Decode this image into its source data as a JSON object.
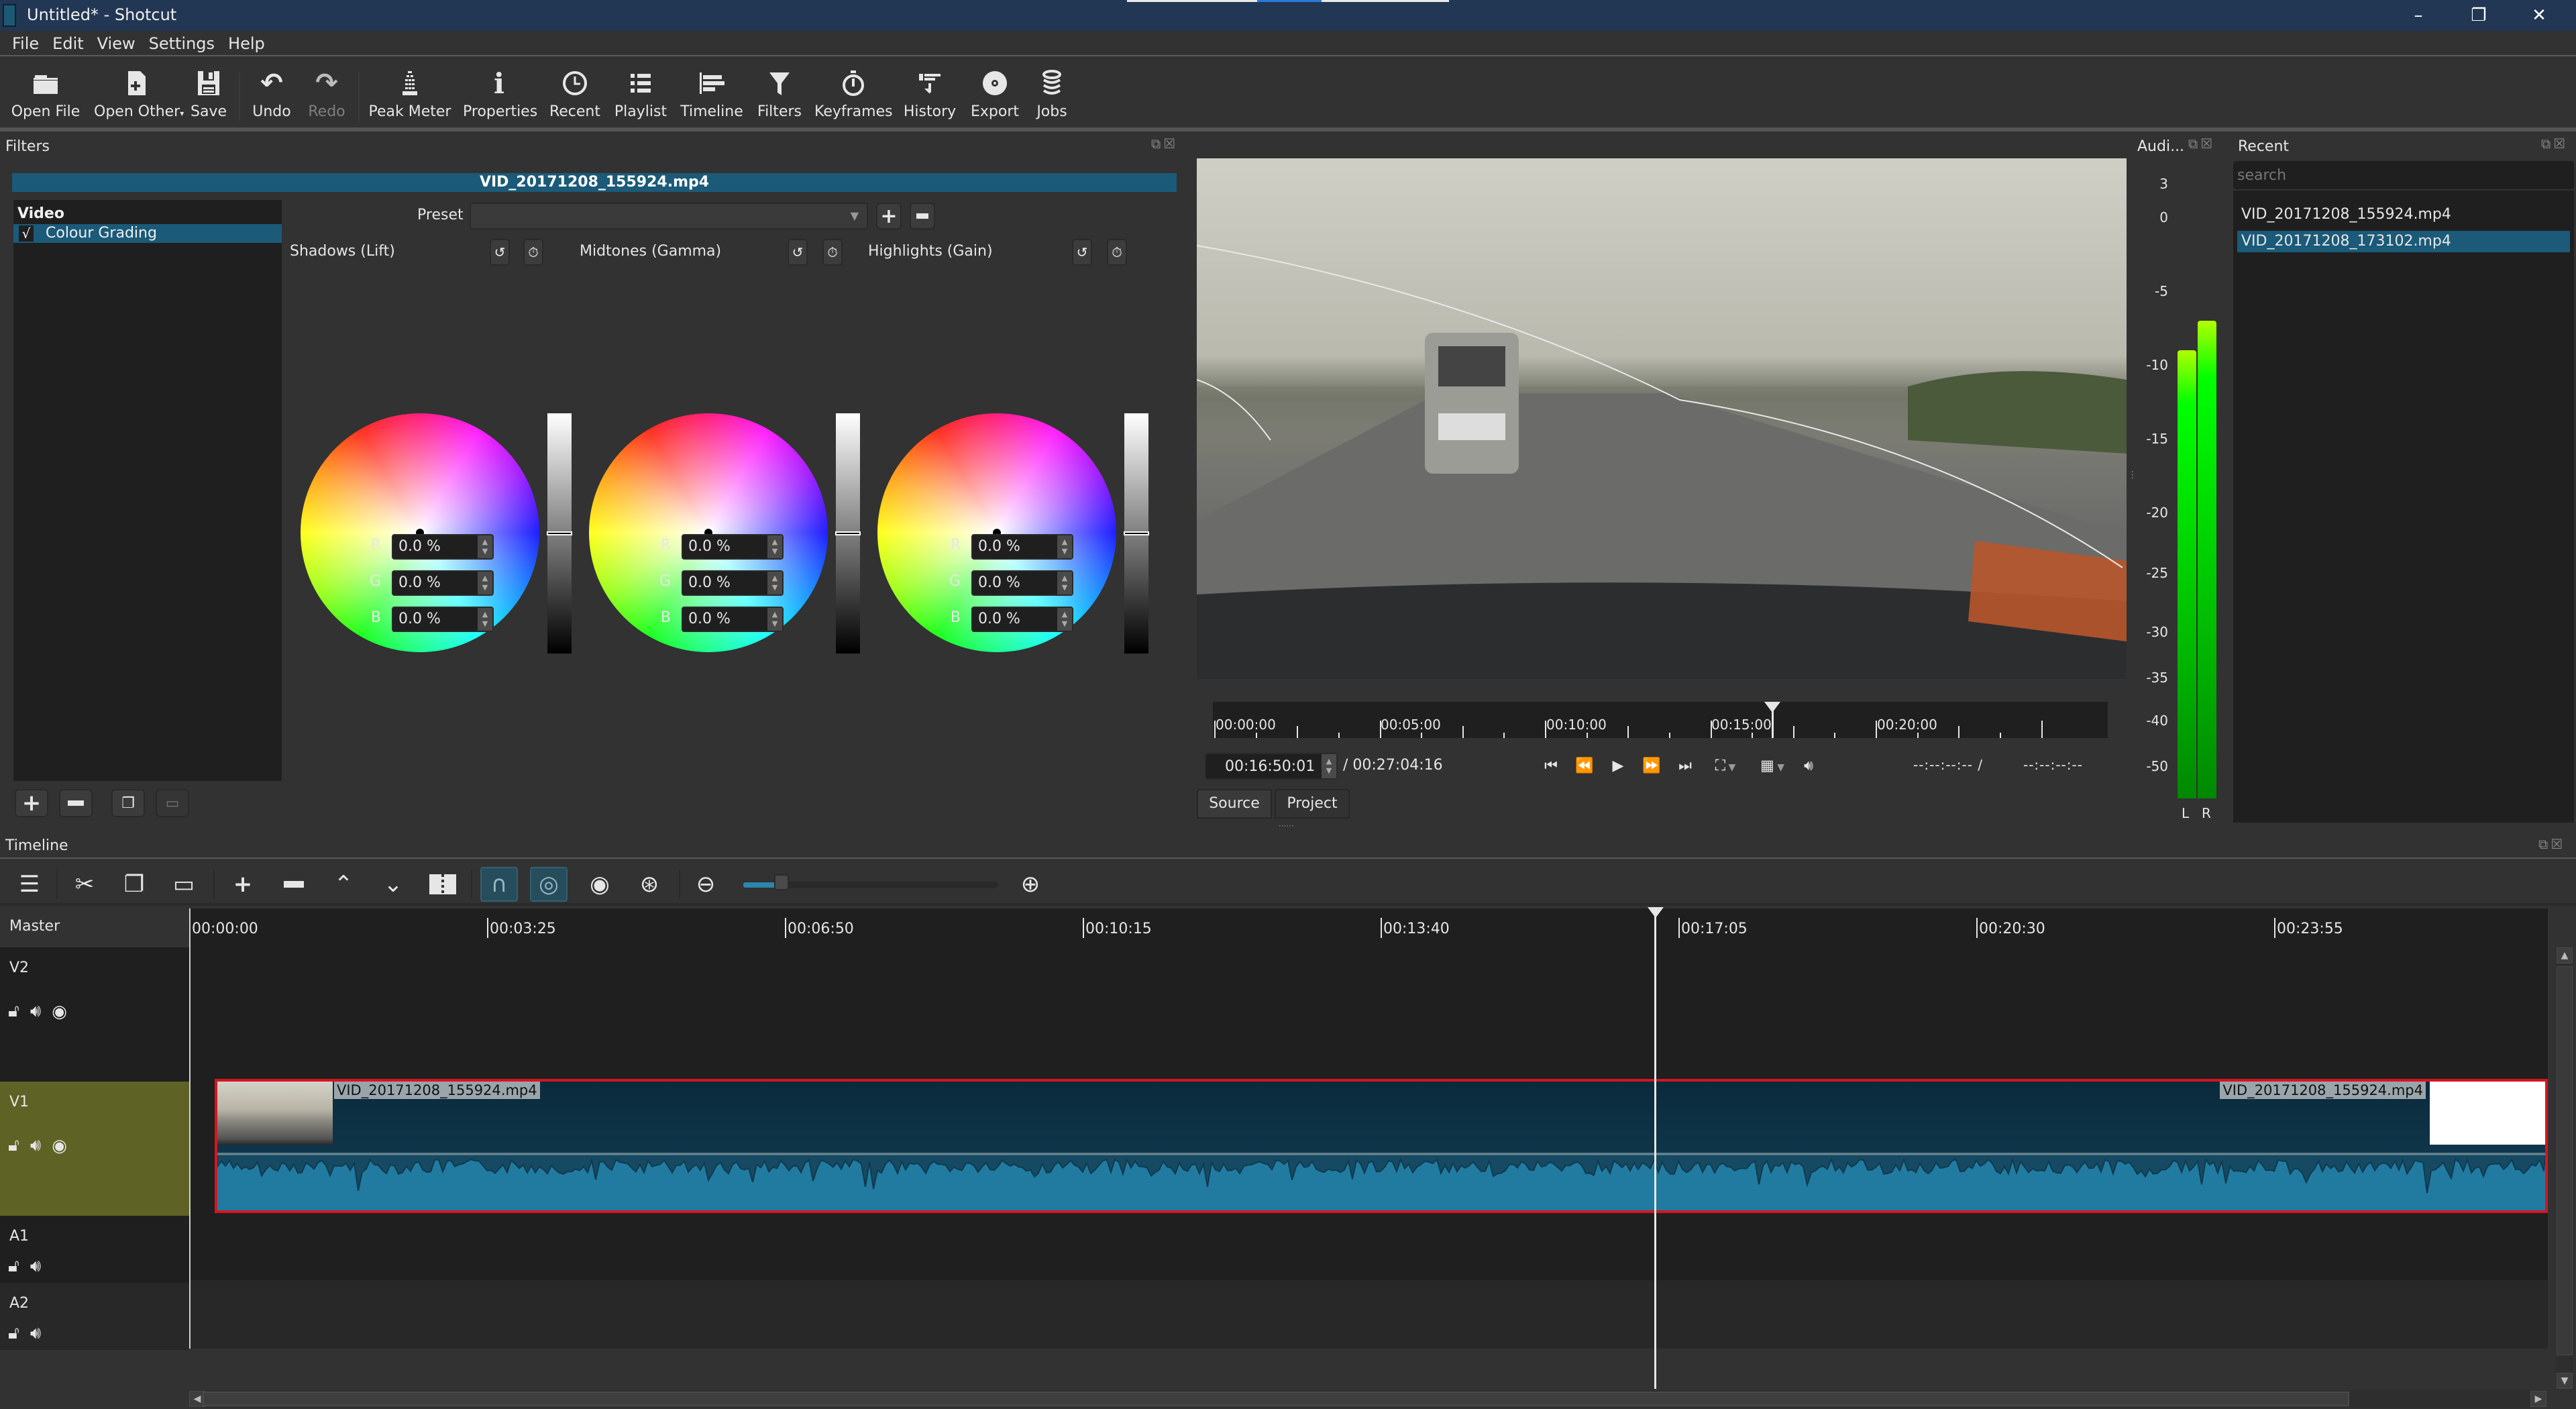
{
  "window": {
    "title": "Untitled* - Shotcut",
    "controls": {
      "minimize": "–",
      "restore": "❐",
      "close": "✕"
    }
  },
  "menu": [
    "File",
    "Edit",
    "View",
    "Settings",
    "Help"
  ],
  "toolbar": [
    {
      "id": "open-file",
      "label": "Open File",
      "icon": "folder-icon"
    },
    {
      "id": "open-other",
      "label": "Open Other",
      "icon": "new-file-icon",
      "has_dropdown": true
    },
    {
      "id": "save",
      "label": "Save",
      "icon": "save-icon"
    },
    {
      "id": "undo",
      "label": "Undo",
      "icon": "undo-icon"
    },
    {
      "id": "redo",
      "label": "Redo",
      "icon": "redo-icon",
      "disabled": true
    },
    {
      "id": "peak-meter",
      "label": "Peak Meter",
      "icon": "peak-meter-icon"
    },
    {
      "id": "properties",
      "label": "Properties",
      "icon": "info-icon"
    },
    {
      "id": "recent",
      "label": "Recent",
      "icon": "clock-icon"
    },
    {
      "id": "playlist",
      "label": "Playlist",
      "icon": "list-icon"
    },
    {
      "id": "timeline",
      "label": "Timeline",
      "icon": "timeline-icon"
    },
    {
      "id": "filters",
      "label": "Filters",
      "icon": "funnel-icon"
    },
    {
      "id": "keyframes",
      "label": "Keyframes",
      "icon": "stopwatch-icon"
    },
    {
      "id": "history",
      "label": "History",
      "icon": "history-icon"
    },
    {
      "id": "export",
      "label": "Export",
      "icon": "disc-icon"
    },
    {
      "id": "jobs",
      "label": "Jobs",
      "icon": "stack-icon"
    }
  ],
  "filters": {
    "title": "Filters",
    "clip_name": "VID_20171208_155924.mp4",
    "category": "Video",
    "items": [
      {
        "label": "Colour Grading",
        "enabled": true,
        "checkmark": "√"
      }
    ],
    "preset_label": "Preset",
    "preset_value": "",
    "wheels": [
      {
        "title": "Shadows (Lift)",
        "r": "0.0 %",
        "g": "0.0 %",
        "b": "0.0 %"
      },
      {
        "title": "Midtones (Gamma)",
        "r": "0.0 %",
        "g": "0.0 %",
        "b": "0.0 %"
      },
      {
        "title": "Highlights (Gain)",
        "r": "0.0 %",
        "g": "0.0 %",
        "b": "0.0 %"
      }
    ],
    "channel_labels": {
      "r": "R",
      "g": "G",
      "b": "B"
    }
  },
  "player": {
    "ruler_labels": [
      "00:00:00",
      "00:05:00",
      "00:10:00",
      "00:15:00",
      "00:20:00"
    ],
    "position_fraction": 0.6222,
    "current_time": "00:16:50:01",
    "total_time": "/ 00:27:04:16",
    "in_point": "--:--:--:-- /",
    "out_point": "--:--:--:--",
    "tabs": [
      {
        "label": "Source",
        "active": false
      },
      {
        "label": "Project",
        "active": true
      }
    ]
  },
  "audio_meter": {
    "title": "Audi...",
    "scale": [
      "3",
      "0",
      "-5",
      "-10",
      "-15",
      "-20",
      "-25",
      "-30",
      "-35",
      "-40",
      "-50"
    ],
    "channels": [
      {
        "label": "L",
        "level_db": -9
      },
      {
        "label": "R",
        "level_db": -7
      }
    ]
  },
  "recent": {
    "title": "Recent",
    "search_placeholder": "search",
    "items": [
      {
        "label": "VID_20171208_155924.mp4",
        "selected": false
      },
      {
        "label": "VID_20171208_173102.mp4",
        "selected": true
      }
    ]
  },
  "timeline": {
    "title": "Timeline",
    "zoom_fraction": 0.12,
    "ruler_labels": [
      "00:00:00",
      "00:03:25",
      "00:06:50",
      "00:10:15",
      "00:13:40",
      "00:17:05",
      "00:20:30",
      "00:23:55"
    ],
    "master_label": "Master",
    "tracks": [
      {
        "name": "V2",
        "type": "video",
        "icons": [
          "lock-open-icon",
          "speaker-icon",
          "eye-icon"
        ]
      },
      {
        "name": "V1",
        "type": "video",
        "selected": true,
        "icons": [
          "lock-open-icon",
          "speaker-icon",
          "eye-icon"
        ]
      },
      {
        "name": "A1",
        "type": "audio",
        "icons": [
          "lock-open-icon",
          "speaker-icon"
        ]
      },
      {
        "name": "A2",
        "type": "audio",
        "icons": [
          "lock-open-icon",
          "speaker-icon"
        ]
      }
    ],
    "clip": {
      "name": "VID_20171208_155924.mp4",
      "track": "V1"
    },
    "playhead_time": "00:16:50:01"
  },
  "colors": {
    "accent": "#1b5a78",
    "selected_track": "#5f6225",
    "clip_border": "#d8141e",
    "waveform": "#217ba0",
    "titlebar": "#223753"
  }
}
